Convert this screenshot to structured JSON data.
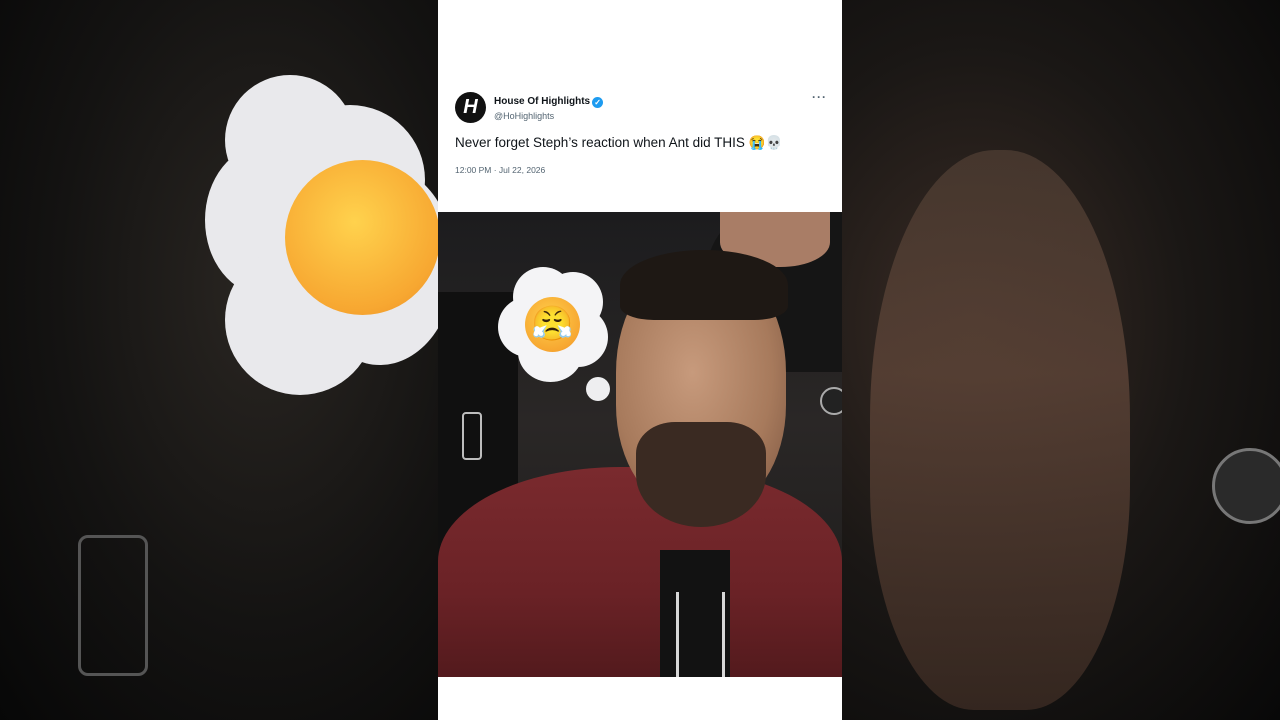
{
  "tweet": {
    "display_name": "House Of Highlights",
    "handle": "@HoHighlights",
    "avatar_letter": "H",
    "verified_mark": "✓",
    "more_label": "···",
    "text": "Never forget Steph’s reaction when Ant did THIS 😭💀",
    "timestamp": "12:00 PM · Jul 22, 2026"
  },
  "video": {
    "thought_emoji": "😤",
    "thought_emoji_name": "face-with-steam-from-nose"
  },
  "colors": {
    "verified_blue": "#1d9bf0",
    "jacket_maroon": "#6a2226",
    "text_primary": "#0f1419",
    "text_secondary": "#536471"
  }
}
